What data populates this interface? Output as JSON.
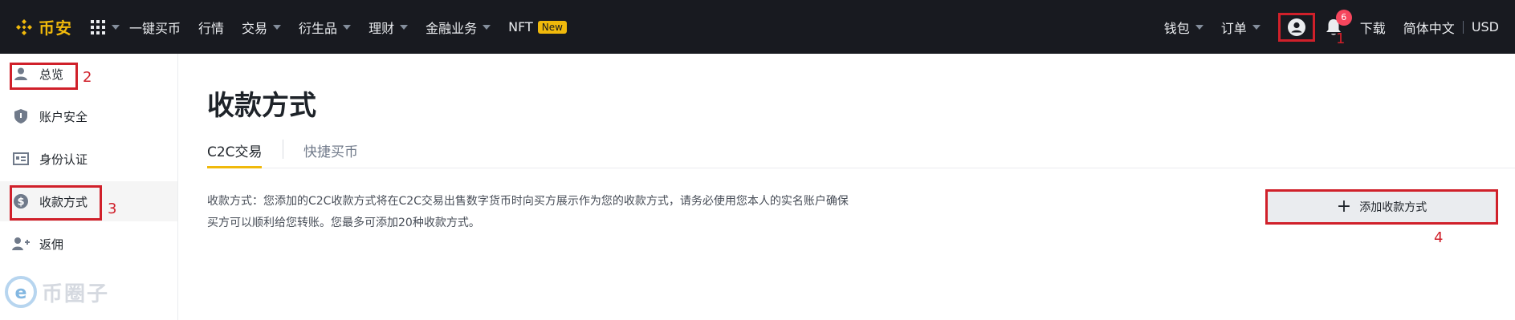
{
  "topbar": {
    "logo_text": "币安",
    "nav": [
      {
        "label": "一键买币",
        "has_caret": false
      },
      {
        "label": "行情",
        "has_caret": false
      },
      {
        "label": "交易",
        "has_caret": true
      },
      {
        "label": "衍生品",
        "has_caret": true
      },
      {
        "label": "理财",
        "has_caret": true
      },
      {
        "label": "金融业务",
        "has_caret": true
      },
      {
        "label": "NFT",
        "has_caret": false,
        "badge": "New"
      }
    ],
    "wallet": "钱包",
    "orders": "订单",
    "notification_count": "6",
    "download": "下载",
    "language": "简体中文",
    "currency": "USD"
  },
  "sidebar": {
    "items": [
      {
        "label": "总览",
        "icon": "user-icon"
      },
      {
        "label": "账户安全",
        "icon": "shield-icon"
      },
      {
        "label": "身份认证",
        "icon": "id-card-icon"
      },
      {
        "label": "收款方式",
        "icon": "dollar-icon",
        "active": true
      },
      {
        "label": "返佣",
        "icon": "add-user-icon"
      }
    ],
    "watermark": "币圈子"
  },
  "annotations": {
    "a1": "1",
    "a2": "2",
    "a3": "3",
    "a4": "4"
  },
  "main": {
    "title": "收款方式",
    "tabs": [
      {
        "label": "C2C交易",
        "active": true
      },
      {
        "label": "快捷买币",
        "active": false
      }
    ],
    "description": "收款方式：您添加的C2C收款方式将在C2C交易出售数字货币时向买方展示作为您的收款方式，请务必使用您本人的实名账户确保买方可以顺利给您转账。您最多可添加20种收款方式。",
    "add_button": "添加收款方式"
  },
  "colors": {
    "brand": "#f0b90b",
    "topbar_bg": "#181a20",
    "annotation_red": "#d0202a",
    "badge_red": "#f6465d"
  }
}
